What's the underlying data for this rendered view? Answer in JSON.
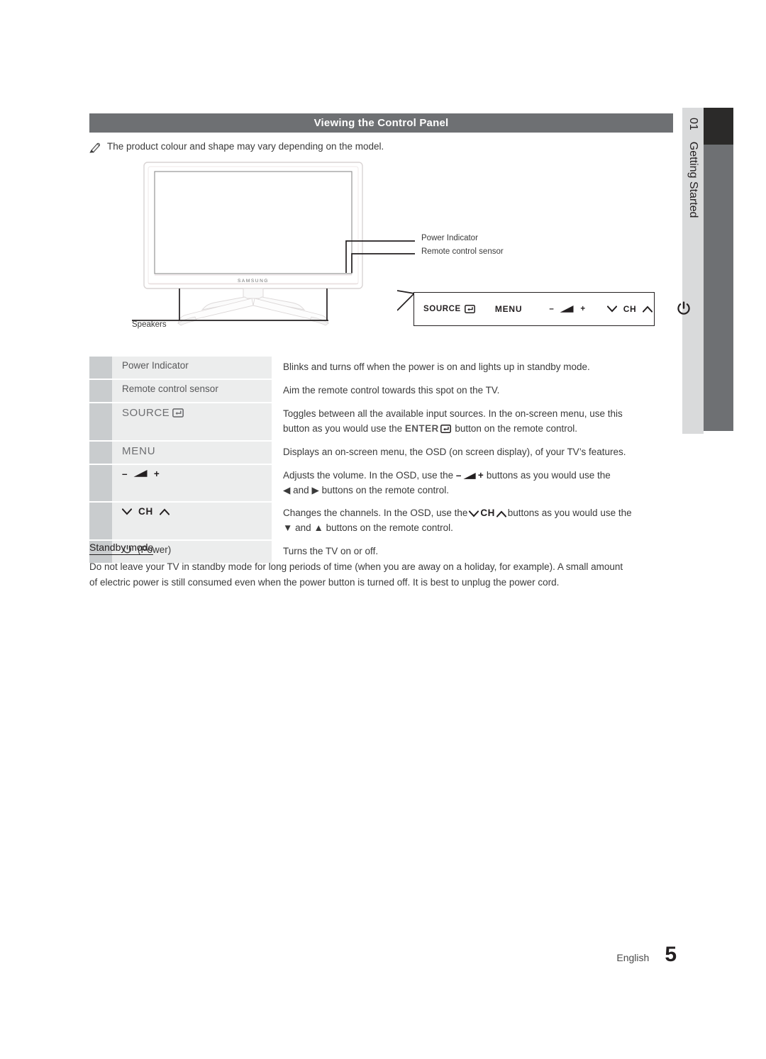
{
  "header": {
    "title": "Viewing the Control Panel"
  },
  "note": {
    "icon": "note-pencil-icon",
    "text": "The product colour and shape may vary depending on the model."
  },
  "illustration": {
    "brand_logo": "SAMSUNG",
    "callouts": {
      "power_indicator": "Power Indicator",
      "remote_control_sensor": "Remote control sensor",
      "speakers": "Speakers"
    }
  },
  "control_panel": {
    "source_label": "SOURCE",
    "source_icon": "enter-arrow-icon",
    "menu_label": "MENU",
    "volume": {
      "minus": "–",
      "icon": "volume-wedge-icon",
      "plus": "+"
    },
    "channel": {
      "down_icon": "chevron-down-icon",
      "label": "CH",
      "up_icon": "chevron-up-icon"
    },
    "power_icon": "power-icon"
  },
  "table": {
    "rows": [
      {
        "kind": "text",
        "label": "Power Indicator",
        "desc_lines": [
          "Blinks and turns off when the power is on and lights up in standby mode."
        ]
      },
      {
        "kind": "text",
        "label": "Remote control sensor",
        "desc_lines": [
          "Aim the remote control towards this spot on the TV."
        ]
      },
      {
        "kind": "source",
        "label": "SOURCE",
        "label_icon": "enter-arrow-icon",
        "desc_lines": [
          "Toggles between all the available input sources. In the on-screen menu, use this",
          "button as you would use the ENTER⏎ button on the remote control."
        ],
        "desc_part_1": "Toggles between all the available input sources. In the on-screen menu, use this",
        "desc_part_2a": "button as you would use the ",
        "desc_key": "ENTER",
        "desc_part_2b": " button on the remote control."
      },
      {
        "kind": "menu",
        "label": "MENU",
        "desc_lines": [
          "Displays an on-screen menu, the OSD (on screen display), of your TV’s features."
        ]
      },
      {
        "kind": "volume",
        "label_minus": "–",
        "label_plus": "+",
        "desc_part_1": "Adjusts the volume. In the OSD, use the",
        "desc_part_2": "buttons as you would use the",
        "desc_part_3a": "and",
        "desc_part_3b": "buttons on the remote control.",
        "arrow_left": "◀",
        "arrow_right": "▶"
      },
      {
        "kind": "channel",
        "label": "CH",
        "desc_part_1": "Changes the channels. In the OSD, use the",
        "desc_key": "CH",
        "desc_part_2": "buttons as you would use the",
        "desc_part_3a": "and",
        "desc_part_3b": "buttons on the remote control.",
        "arrow_down": "▼",
        "arrow_up": "▲"
      },
      {
        "kind": "power",
        "label": "(Power)",
        "desc_lines": [
          "Turns the TV on or off."
        ]
      }
    ]
  },
  "standby": {
    "heading": "Standby mode",
    "line_1": "Do not leave your TV in standby mode for long periods of time (when you are away on a holiday, for example). A small amount",
    "line_2": "of electric power is still consumed even when the power button is turned off. It is best to unplug the power cord."
  },
  "chapter_tab": {
    "number": "01",
    "title": "Getting Started"
  },
  "footer": {
    "language": "English",
    "page_number": "5"
  },
  "colors": {
    "header_bar": "#6e7073",
    "tab_light": "#d9dadb",
    "tab_dark": "#2b2a29",
    "swatch": "#c9ccce",
    "label_cell": "#eceded",
    "text": "#231f20"
  }
}
